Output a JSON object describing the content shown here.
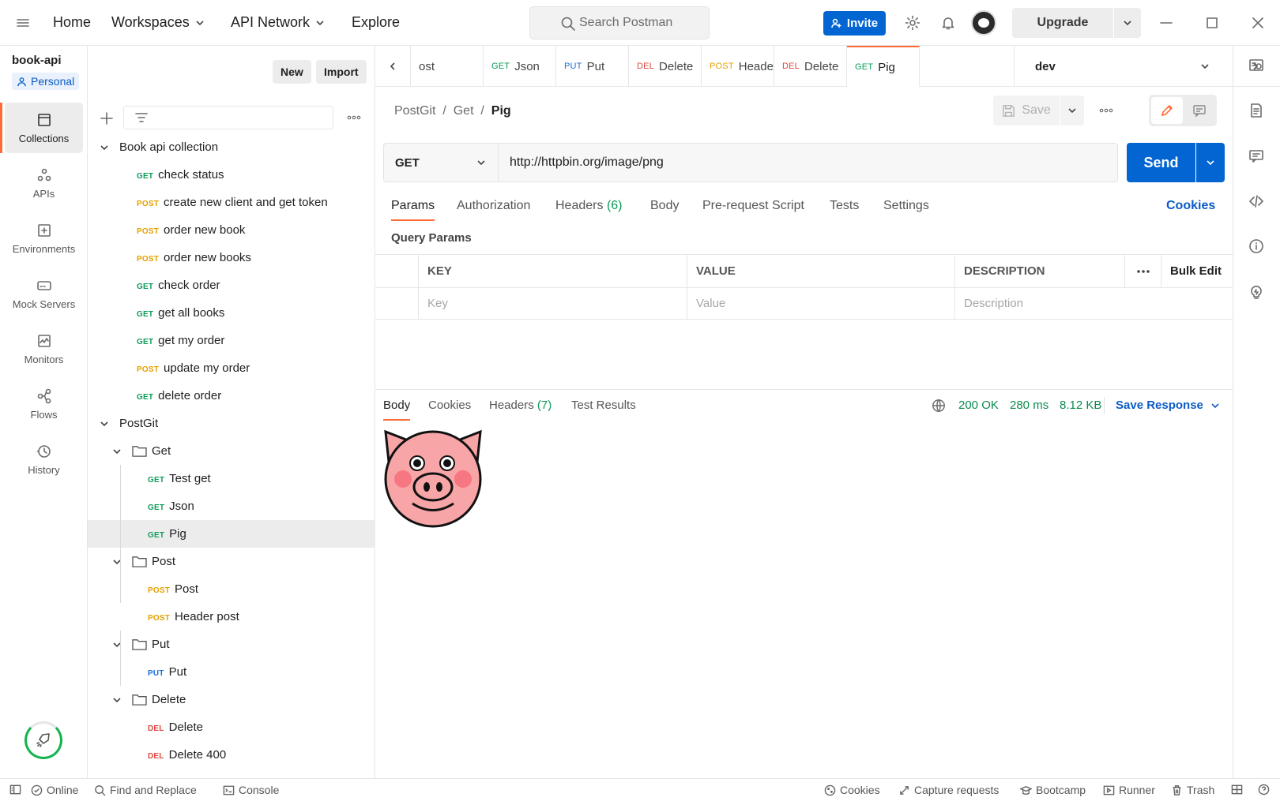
{
  "header": {
    "nav": [
      "Home",
      "Workspaces",
      "API Network",
      "Explore"
    ],
    "search_placeholder": "Search Postman",
    "invite_label": "Invite",
    "upgrade_label": "Upgrade"
  },
  "workspace": {
    "name": "book-api",
    "visibility": "Personal",
    "new_label": "New",
    "import_label": "Import"
  },
  "rail": [
    {
      "label": "Collections",
      "icon": "collections-icon"
    },
    {
      "label": "APIs",
      "icon": "apis-icon"
    },
    {
      "label": "Environments",
      "icon": "environments-icon"
    },
    {
      "label": "Mock Servers",
      "icon": "mock-servers-icon"
    },
    {
      "label": "Monitors",
      "icon": "monitors-icon"
    },
    {
      "label": "Flows",
      "icon": "flows-icon"
    },
    {
      "label": "History",
      "icon": "history-icon"
    }
  ],
  "tree": [
    {
      "type": "collection",
      "label": "Book api collection"
    },
    {
      "type": "request",
      "method": "GET",
      "label": "check status"
    },
    {
      "type": "request",
      "method": "POST",
      "label": "create new client and get token"
    },
    {
      "type": "request",
      "method": "POST",
      "label": "order new book"
    },
    {
      "type": "request",
      "method": "POST",
      "label": "order new books"
    },
    {
      "type": "request",
      "method": "GET",
      "label": "check order"
    },
    {
      "type": "request",
      "method": "GET",
      "label": "get all books"
    },
    {
      "type": "request",
      "method": "GET",
      "label": "get my order"
    },
    {
      "type": "request",
      "method": "POST",
      "label": "update my order"
    },
    {
      "type": "request",
      "method": "GET",
      "label": "delete order"
    },
    {
      "type": "collection",
      "label": "PostGit"
    },
    {
      "type": "folder",
      "label": "Get"
    },
    {
      "type": "subrequest",
      "method": "GET",
      "label": "Test get"
    },
    {
      "type": "subrequest",
      "method": "GET",
      "label": "Json"
    },
    {
      "type": "subrequest",
      "method": "GET",
      "label": "Pig",
      "selected": true
    },
    {
      "type": "folder",
      "label": "Post"
    },
    {
      "type": "subrequest",
      "method": "POST",
      "label": "Post"
    },
    {
      "type": "subrequest",
      "method": "POST",
      "label": "Header post"
    },
    {
      "type": "folder",
      "label": "Put"
    },
    {
      "type": "subrequest",
      "method": "PUT",
      "label": "Put"
    },
    {
      "type": "folder",
      "label": "Delete"
    },
    {
      "type": "subrequest",
      "method": "DEL",
      "label": "Delete"
    },
    {
      "type": "subrequest",
      "method": "DEL",
      "label": "Delete 400"
    }
  ],
  "tabs": [
    {
      "method": "",
      "label": "ost"
    },
    {
      "method": "GET",
      "label": "Json"
    },
    {
      "method": "PUT",
      "label": "Put"
    },
    {
      "method": "DEL",
      "label": "Delete"
    },
    {
      "method": "POST",
      "label": "Heade"
    },
    {
      "method": "DEL",
      "label": "Delete"
    },
    {
      "method": "GET",
      "label": "Pig",
      "active": true
    }
  ],
  "environment": "dev",
  "request": {
    "breadcrumb": [
      "PostGit",
      "Get",
      "Pig"
    ],
    "save_label": "Save",
    "method": "GET",
    "url": "http://httpbin.org/image/png",
    "send_label": "Send",
    "tabs": [
      "Params",
      "Authorization",
      "Headers",
      "Body",
      "Pre-request Script",
      "Tests",
      "Settings"
    ],
    "headers_count": "(6)",
    "cookies_link": "Cookies",
    "query_params_title": "Query Params",
    "columns": [
      "KEY",
      "VALUE",
      "DESCRIPTION"
    ],
    "bulk_edit": "Bulk Edit",
    "placeholders": [
      "Key",
      "Value",
      "Description"
    ]
  },
  "response": {
    "tabs": [
      "Body",
      "Cookies",
      "Headers",
      "Test Results"
    ],
    "headers_count": "(7)",
    "status": "200 OK",
    "time": "280 ms",
    "size": "8.12 KB",
    "save_response": "Save Response",
    "image": "pig-face-image"
  },
  "footer": {
    "left": [
      "Online",
      "Find and Replace",
      "Console"
    ],
    "right": [
      "Cookies",
      "Capture requests",
      "Bootcamp",
      "Runner",
      "Trash"
    ]
  },
  "colors": {
    "accent": "#ff6c37",
    "primary": "#0265d2",
    "get": "#0d9b59",
    "post": "#e3a100",
    "put": "#1d6fd6",
    "delete": "#e0473c"
  }
}
